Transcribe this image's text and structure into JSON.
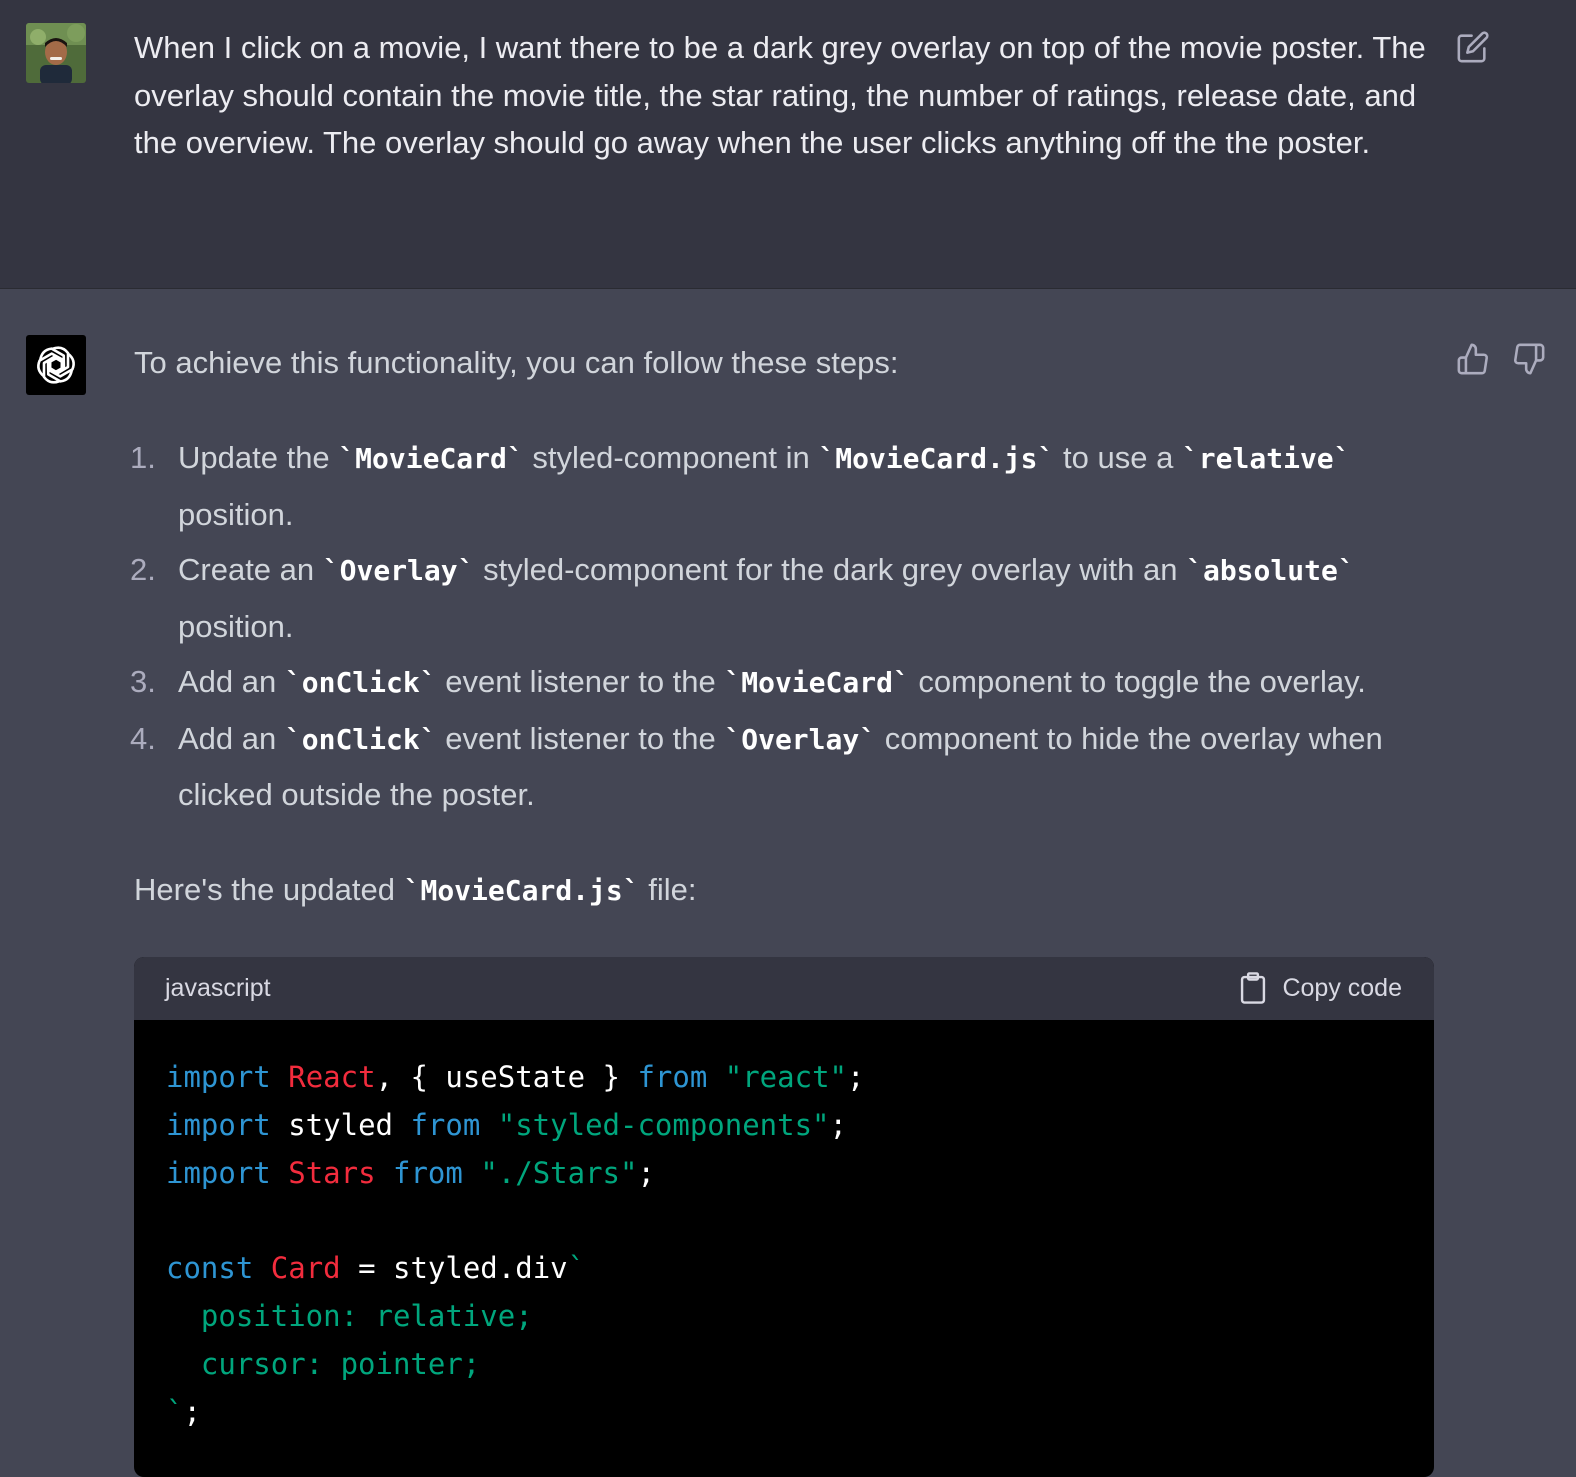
{
  "user_message": {
    "text": "When I click on a movie, I want there to be a dark grey overlay on top of the movie poster. The overlay should contain the movie title, the star rating, the number of ratings, release date, and the overview. The overlay should go away when the user clicks anything off the the poster."
  },
  "assistant_message": {
    "intro": "To achieve this functionality, you can follow these steps:",
    "steps": [
      {
        "number": "1.",
        "parts": [
          "Update the ",
          "`MovieCard`",
          " styled-component in ",
          "`MovieCard.js`",
          " to use a ",
          "`relative`",
          " position."
        ]
      },
      {
        "number": "2.",
        "parts": [
          "Create an ",
          "`Overlay`",
          " styled-component for the dark grey overlay with an ",
          "`absolute`",
          " position."
        ]
      },
      {
        "number": "3.",
        "parts": [
          "Add an ",
          "`onClick`",
          " event listener to the ",
          "`MovieCard`",
          " component to toggle the overlay."
        ]
      },
      {
        "number": "4.",
        "parts": [
          "Add an ",
          "`onClick`",
          " event listener to the ",
          "`Overlay`",
          " component to hide the overlay when clicked outside the poster."
        ]
      }
    ],
    "here_text": [
      "Here's the updated ",
      "`MovieCard.js`",
      " file:"
    ],
    "code_block": {
      "language": "javascript",
      "copy_label": "Copy code",
      "lines": [
        [
          [
            "kw",
            "import"
          ],
          [
            "plain",
            " "
          ],
          [
            "cls",
            "React"
          ],
          [
            "plain",
            ", { useState } "
          ],
          [
            "kw",
            "from"
          ],
          [
            "plain",
            " "
          ],
          [
            "str",
            "\"react\""
          ],
          [
            "plain",
            ";"
          ]
        ],
        [
          [
            "kw",
            "import"
          ],
          [
            "plain",
            " styled "
          ],
          [
            "kw",
            "from"
          ],
          [
            "plain",
            " "
          ],
          [
            "str",
            "\"styled-components\""
          ],
          [
            "plain",
            ";"
          ]
        ],
        [
          [
            "kw",
            "import"
          ],
          [
            "plain",
            " "
          ],
          [
            "cls",
            "Stars"
          ],
          [
            "plain",
            " "
          ],
          [
            "kw",
            "from"
          ],
          [
            "plain",
            " "
          ],
          [
            "str",
            "\"./Stars\""
          ],
          [
            "plain",
            ";"
          ]
        ],
        [],
        [
          [
            "kw",
            "const"
          ],
          [
            "plain",
            " "
          ],
          [
            "cls",
            "Card"
          ],
          [
            "plain",
            " = styled."
          ],
          [
            "plain",
            "div"
          ],
          [
            "str",
            "`"
          ]
        ],
        [
          [
            "str",
            "  position: relative;"
          ]
        ],
        [
          [
            "str",
            "  cursor: pointer;"
          ]
        ],
        [
          [
            "str",
            "`"
          ],
          [
            "plain",
            ";"
          ]
        ]
      ]
    }
  },
  "colors": {
    "user_bg": "#343541",
    "assistant_bg": "#444654",
    "keyword": "#2e95d3",
    "class_name": "#f22c3d",
    "string": "#00a67d"
  }
}
